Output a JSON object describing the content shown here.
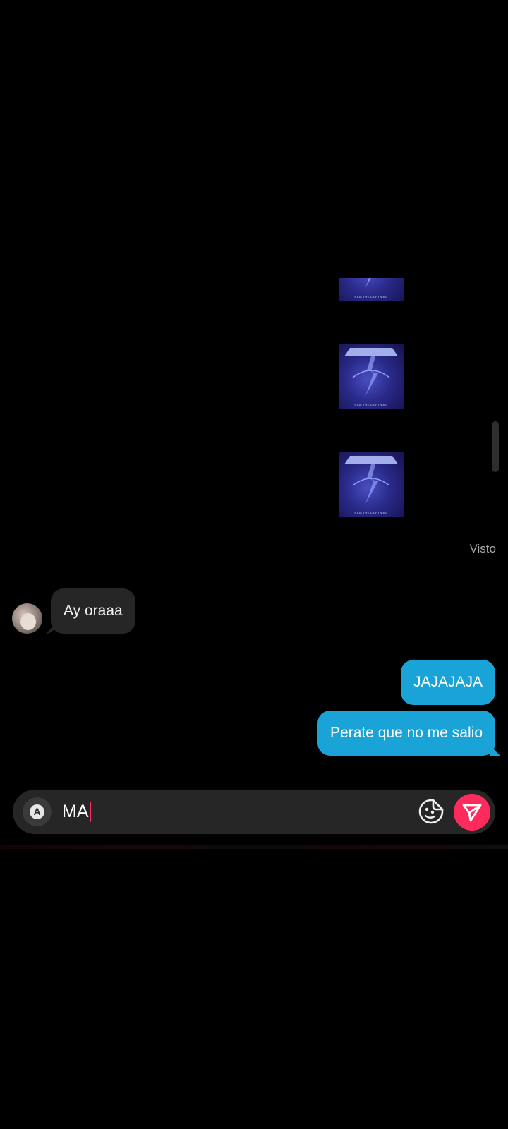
{
  "chat": {
    "album_messages": [
      {
        "title": "Metallica - Ride the Lightning",
        "cover_text": "RIDE THE LIGHTNING",
        "partial": true
      },
      {
        "title": "Metallica - Ride the Lightning",
        "cover_text": "RIDE THE LIGHTNING",
        "partial": false
      },
      {
        "title": "Metallica - Ride the Lightning",
        "cover_text": "RIDE THE LIGHTNING",
        "partial": false
      }
    ],
    "seen_label": "Visto",
    "received": [
      {
        "text": "Ay oraaa"
      }
    ],
    "sent": [
      {
        "text": "JAJAJAJA"
      },
      {
        "text": "Perate que no me salio"
      }
    ]
  },
  "composer": {
    "keyboard_icon": "keyboard-a-icon",
    "keyboard_glyph": "A",
    "input_value": "MA",
    "sticker_icon": "sticker-icon",
    "send_icon": "send-arrow-icon"
  },
  "colors": {
    "background": "#000000",
    "sent_bubble": "#1aa3d6",
    "received_bubble": "#262626",
    "accent": "#ff2b5c",
    "composer_bg": "#262626"
  }
}
